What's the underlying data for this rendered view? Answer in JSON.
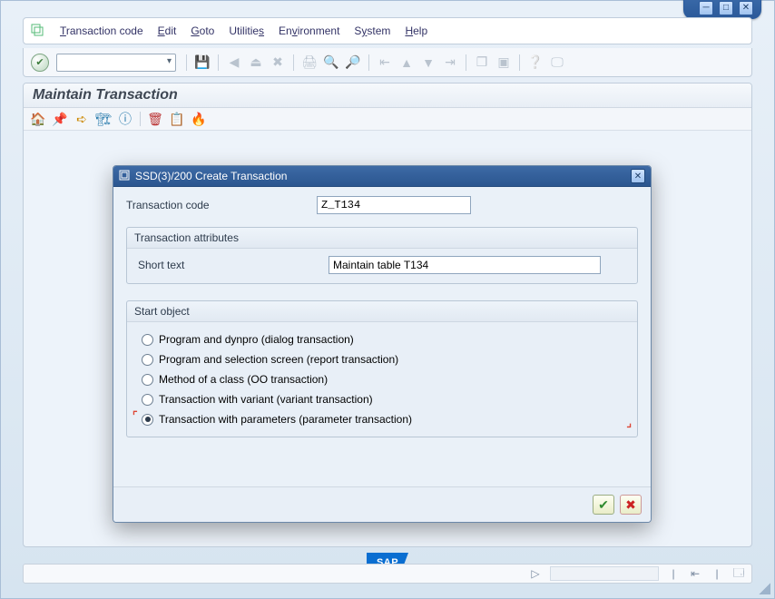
{
  "menubar": {
    "items": [
      {
        "pre": "",
        "u": "T",
        "post": "ransaction code"
      },
      {
        "pre": "",
        "u": "E",
        "post": "dit"
      },
      {
        "pre": "",
        "u": "G",
        "post": "oto"
      },
      {
        "pre": "Utilitie",
        "u": "s",
        "post": ""
      },
      {
        "pre": "En",
        "u": "v",
        "post": "ironment"
      },
      {
        "pre": "S",
        "u": "y",
        "post": "stem"
      },
      {
        "pre": "",
        "u": "H",
        "post": "elp"
      }
    ]
  },
  "page": {
    "title": "Maintain Transaction"
  },
  "dialog": {
    "title": "SSD(3)/200 Create Transaction",
    "tcode_label": "Transaction code",
    "tcode_value": "Z_T134",
    "attrs_group": "Transaction attributes",
    "shorttext_label": "Short text",
    "shorttext_value": "Maintain table T134",
    "startobj_group": "Start object",
    "radios": [
      "Program and dynpro (dialog transaction)",
      "Program and selection screen (report transaction)",
      "Method of a class (OO transaction)",
      "Transaction with variant (variant transaction)",
      "Transaction with parameters (parameter transaction)"
    ],
    "selected_radio_index": 4
  },
  "logo": "SAP"
}
